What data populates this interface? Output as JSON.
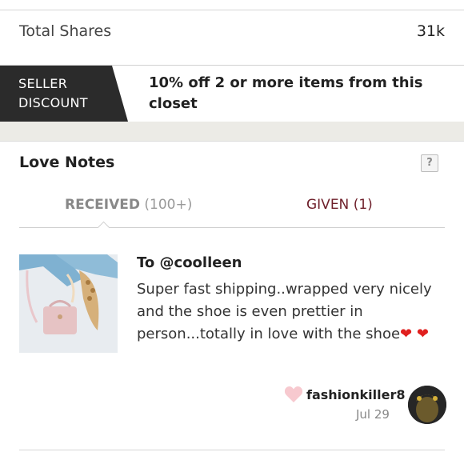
{
  "stats": {
    "total_shares_label": "Total Shares",
    "total_shares_value": "31k"
  },
  "seller_discount": {
    "tag_line1": "SELLER",
    "tag_line2": "DISCOUNT",
    "text": "10% off 2 or more items from this closet"
  },
  "love_notes": {
    "title": "Love Notes",
    "help_label": "?",
    "tabs": [
      {
        "label": "RECEIVED",
        "count": "(100+)",
        "active": true
      },
      {
        "label": "GIVEN",
        "count": "(1)",
        "active": false
      }
    ],
    "note": {
      "to": "To @coolleen",
      "body": "Super fast shipping..wrapped very nicely and the shoe is even prettier in person...totally in love with the shoe",
      "sender": "fashionkiller8",
      "date": "Jul 29"
    }
  },
  "colors": {
    "accent": "#6e1f2a",
    "tag_bg": "#2b2b2b",
    "heart_red": "#e0201f",
    "heart_pink": "#f7c9cf"
  },
  "icons": {
    "help": "question-icon",
    "heart": "heart-icon"
  }
}
